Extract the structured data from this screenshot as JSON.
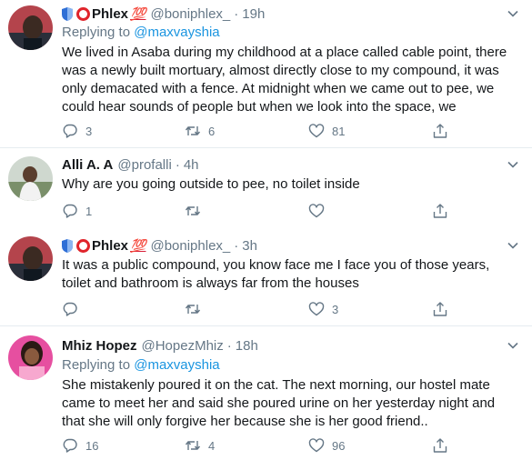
{
  "tweets": [
    {
      "name": "Phlex",
      "emoji_suffix": "💯",
      "handle": "@boniphlex_",
      "time": "19h",
      "replying_label": "Replying to",
      "replying_to": "@maxvayshia",
      "text": "We lived in Asaba during my childhood at a place called cable point, there was a newly built mortuary, almost directly close to my compound, it was only demacated with a fence. At midnight when we came out to pee, we could hear sounds of people but when we look into the space, we",
      "replies": "3",
      "retweets": "6",
      "likes": "81"
    },
    {
      "name": "Alli A. A",
      "handle": "@profalli",
      "time": "4h",
      "text": "Why are you going outside to pee, no toilet inside",
      "replies": "1",
      "retweets": "",
      "likes": ""
    },
    {
      "name": "Phlex",
      "emoji_suffix": "💯",
      "handle": "@boniphlex_",
      "time": "3h",
      "text": "It was a public compound, you know face me I face you of those years, toilet and bathroom is always far from the houses",
      "replies": "",
      "retweets": "",
      "likes": "3"
    },
    {
      "name": "Mhiz Hopez",
      "handle": "@HopezMhiz",
      "time": "18h",
      "replying_label": "Replying to",
      "replying_to": "@maxvayshia",
      "text": "She mistakenly poured it on the cat. The next morning, our hostel mate came to meet her and said she poured urine on her yesterday night and that she will only forgive her because she is her good friend..",
      "replies": "16",
      "retweets": "4",
      "likes": "96"
    }
  ],
  "icons": {
    "reply": "reply-icon",
    "retweet": "retweet-icon",
    "like": "heart-icon",
    "share": "share-icon",
    "more": "chevron-down-icon",
    "badge_shield": "shield-icon",
    "badge_ring": "red-circle-icon"
  },
  "colors": {
    "text": "#14171a",
    "secondary": "#657786",
    "link": "#1b95e0",
    "divider": "#e6ecf0",
    "ring": "#e0242b"
  }
}
